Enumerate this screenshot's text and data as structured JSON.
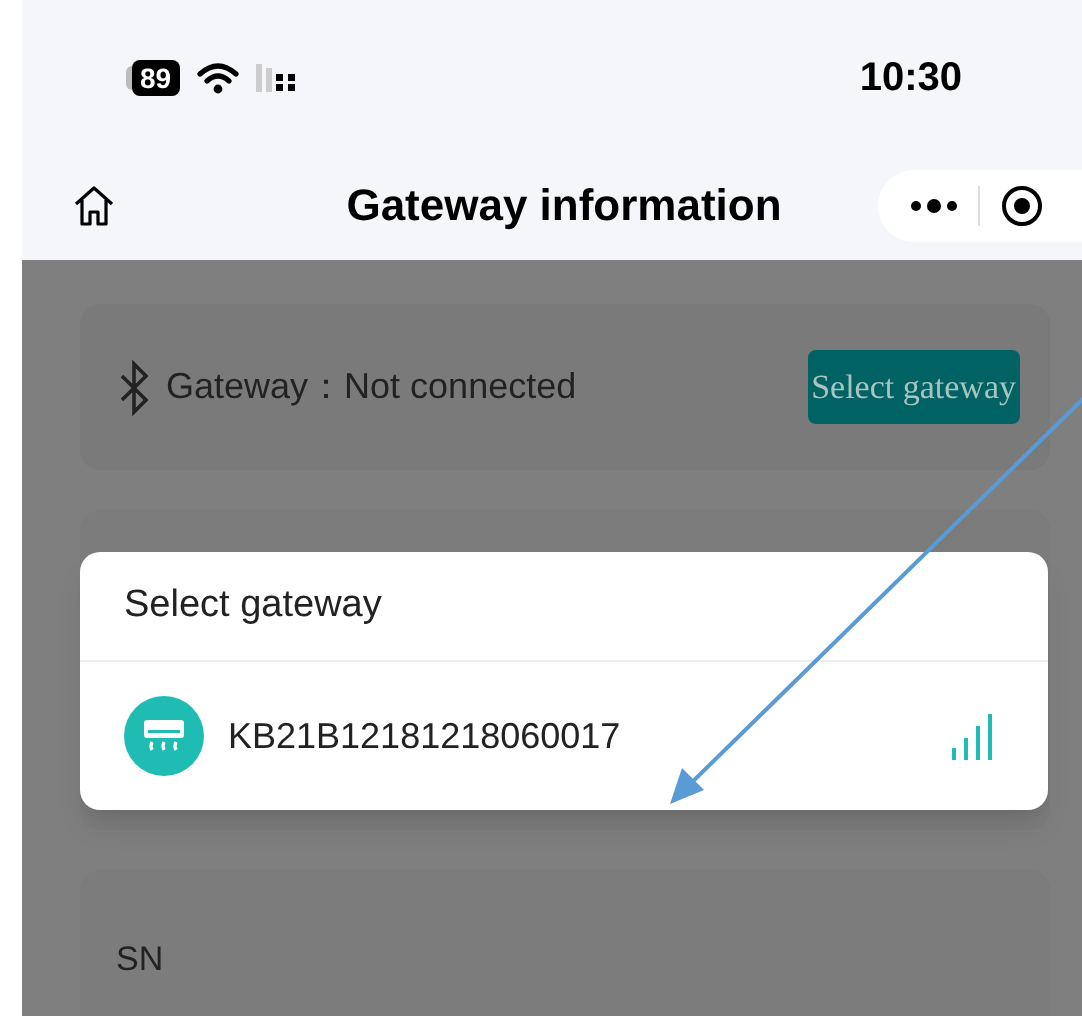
{
  "status_bar": {
    "battery": "89",
    "time": "10:30"
  },
  "nav_bar": {
    "title": "Gateway information"
  },
  "gateway_card": {
    "label": "Gateway：Not connected",
    "button": "Select gateway"
  },
  "dialog": {
    "title": "Select gateway",
    "items": [
      {
        "name": "KB21B12181218060017"
      }
    ]
  },
  "sn_card": {
    "label": "SN"
  }
}
